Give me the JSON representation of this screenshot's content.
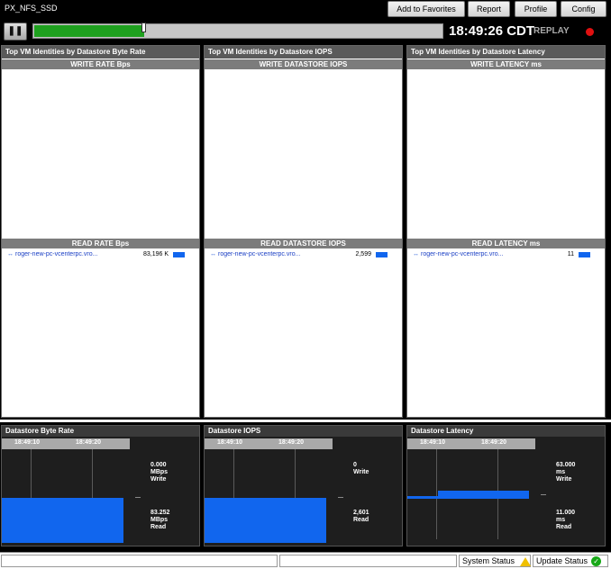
{
  "app": {
    "title": "PX_NFS_SSD"
  },
  "header": {
    "buttons": [
      "Add to Favorites",
      "Report",
      "Profile",
      "Config"
    ]
  },
  "toolbar": {
    "clock": "18:49:26 CDT",
    "replay": "REPLAY",
    "timeline_progress_pct": 27
  },
  "panels": [
    {
      "title": "Top VM Identities by Datastore Byte Rate",
      "write_header": "WRITE RATE Bps",
      "read_header": "READ RATE Bps",
      "read_rows": [
        {
          "name": "roger-new-pc-vcenterpc.vro...",
          "value": "83,196 K"
        }
      ]
    },
    {
      "title": "Top VM Identities by Datastore IOPS",
      "write_header": "WRITE DATASTORE IOPS",
      "read_header": "READ DATASTORE IOPS",
      "read_rows": [
        {
          "name": "roger-new-pc-vcenterpc.vro...",
          "value": "2,599"
        }
      ]
    },
    {
      "title": "Top VM Identities by Datastore Latency",
      "write_header": "WRITE LATENCY ms",
      "read_header": "READ LATENCY ms",
      "read_rows": [
        {
          "name": "roger-new-pc-vcenterpc.vro...",
          "value": "11"
        }
      ]
    }
  ],
  "graphs": [
    {
      "title": "Datastore Byte Rate",
      "times": [
        "18:49:10",
        "18:49:20"
      ],
      "write_value": "0.000",
      "write_unit": "MBps",
      "write_label": "Write",
      "read_value": "83.252",
      "read_unit": "MBps",
      "read_label": "Read"
    },
    {
      "title": "Datastore IOPS",
      "times": [
        "18:49:10",
        "18:49:20"
      ],
      "write_value": "0",
      "write_unit": "",
      "write_label": "Write",
      "read_value": "2,601",
      "read_unit": "",
      "read_label": "Read"
    },
    {
      "title": "Datastore Latency",
      "times": [
        "18:49:10",
        "18:49:20"
      ],
      "write_value": "63.000",
      "write_unit": "ms",
      "write_label": "Write",
      "read_value": "11.000",
      "read_unit": "ms",
      "read_label": "Read"
    }
  ],
  "status": {
    "system": "System Status",
    "update": "Update Status"
  },
  "colors": {
    "accent_blue": "#1166ee",
    "progress_green": "#1ea01e",
    "record_red": "#e01010"
  }
}
